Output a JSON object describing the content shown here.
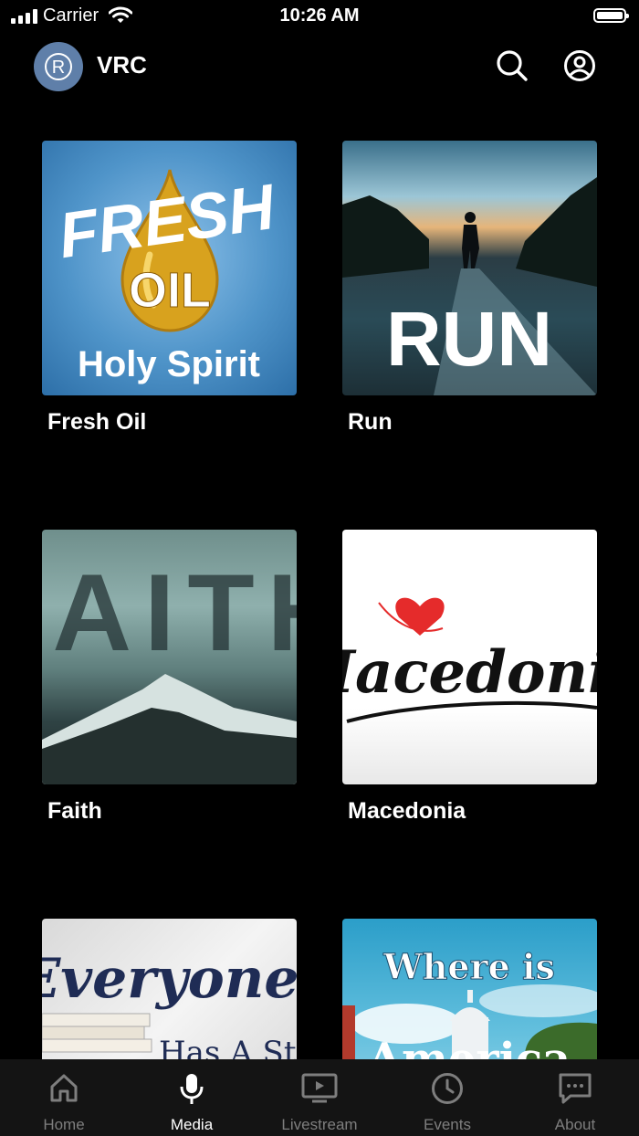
{
  "status_bar": {
    "carrier": "Carrier",
    "time": "10:26 AM"
  },
  "header": {
    "brand": "VRC",
    "logo_letter": "R"
  },
  "media_items": [
    {
      "title": "Fresh Oil",
      "art_lines": [
        "FRESH",
        "OIL",
        "Holy Spirit"
      ]
    },
    {
      "title": "Run",
      "art_lines": [
        "RUN"
      ]
    },
    {
      "title": "Faith",
      "art_lines": [
        "FAITH"
      ]
    },
    {
      "title": "Macedonia",
      "art_lines": [
        "Macedonia"
      ]
    },
    {
      "title": "",
      "art_lines": [
        "Everyone",
        "Has A Sto"
      ]
    },
    {
      "title": "",
      "art_lines": [
        "Where is",
        "America"
      ]
    }
  ],
  "tabs": [
    {
      "label": "Home",
      "icon": "home-icon"
    },
    {
      "label": "Media",
      "icon": "microphone-icon"
    },
    {
      "label": "Livestream",
      "icon": "tv-play-icon"
    },
    {
      "label": "Events",
      "icon": "clock-icon"
    },
    {
      "label": "About",
      "icon": "chat-bubble-icon"
    }
  ],
  "colors": {
    "background": "#000000",
    "tab_active": "#ffffff",
    "tab_inactive": "#7e7e7e",
    "logo_bg": "#5f7fa9"
  }
}
